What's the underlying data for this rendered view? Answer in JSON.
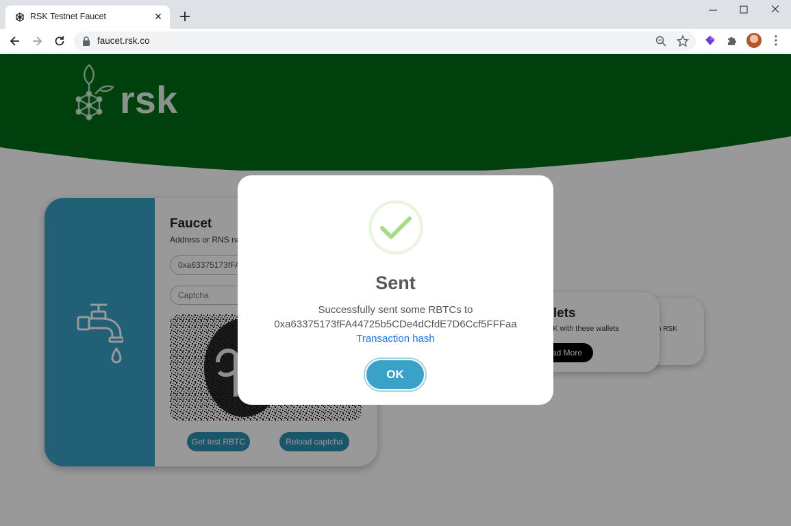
{
  "browser": {
    "tab_title": "RSK Testnet Faucet",
    "tab_close": "✕",
    "url": "faucet.rsk.co"
  },
  "faucet": {
    "title": "Faucet",
    "subtitle": "Address or RNS na",
    "address_value": "0xa63375173fFA4",
    "captcha_placeholder": "Captcha",
    "get_button": "Get test RBTC",
    "reload_button": "Reload captcha"
  },
  "wallets": {
    "title": "allets",
    "subtitle": "RSK with these wallets",
    "read_more": "ad More",
    "back_card_snippet": "n RSK"
  },
  "modal": {
    "title": "Sent",
    "message": "Successfully sent some RBTCs to",
    "address": "0xa63375173fFA44725b5CDe4dCfdE7D6Ccf5FFFaa",
    "link": "Transaction hash",
    "ok_button": "OK"
  },
  "colors": {
    "brand_green": "#006b15",
    "accent_blue": "#3aa1c9",
    "success_green": "#a5dc86"
  }
}
